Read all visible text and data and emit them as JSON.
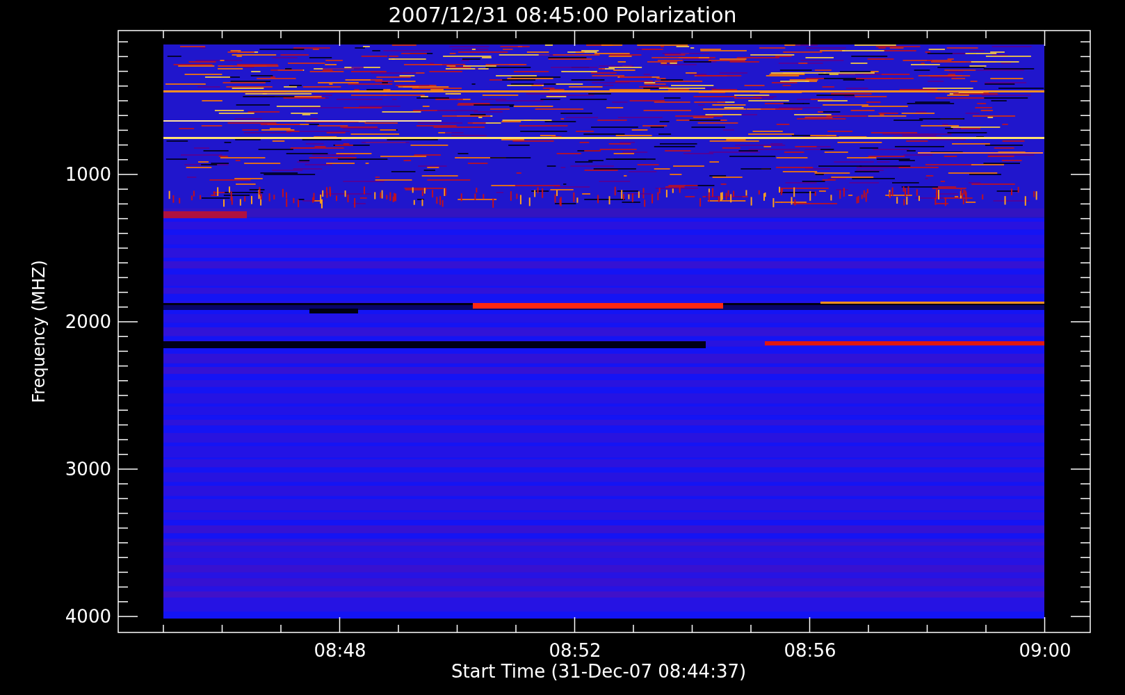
{
  "title": "2007/12/31 08:45:00 Polarization",
  "y_axis": {
    "label": "Frequency (MHZ)",
    "ticks": [
      "1000",
      "2000",
      "3000",
      "4000"
    ]
  },
  "x_axis": {
    "label": "Start Time (31-Dec-07 08:44:37)",
    "ticks": [
      "08:48",
      "08:52",
      "08:56",
      "09:00"
    ]
  }
}
